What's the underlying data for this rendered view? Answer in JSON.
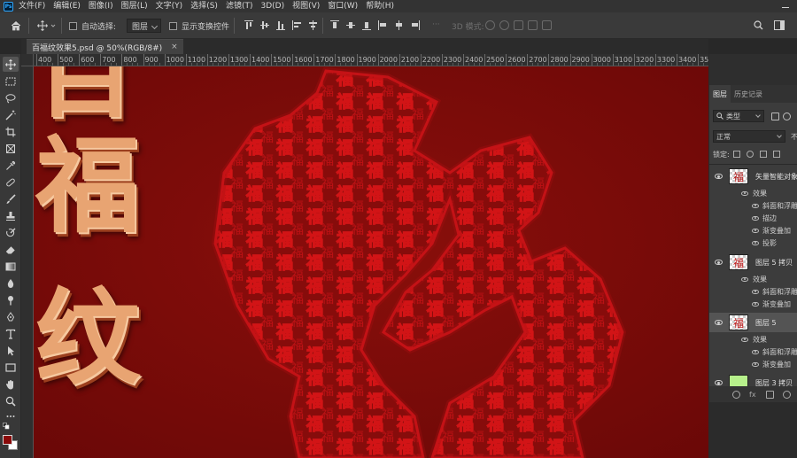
{
  "menu": {
    "items": [
      "文件(F)",
      "编辑(E)",
      "图像(I)",
      "图层(L)",
      "文字(Y)",
      "选择(S)",
      "滤镜(T)",
      "3D(D)",
      "视图(V)",
      "窗口(W)",
      "帮助(H)"
    ]
  },
  "options_bar": {
    "auto_select_label": "自动选择:",
    "auto_select_value": "图层",
    "show_transform_label": "显示变换控件",
    "mode_3d_label": "3D 模式:"
  },
  "document_tab": {
    "title": "百福纹效果5.psd @ 50%(RGB/8#)",
    "close": "×"
  },
  "ruler": {
    "labels": [
      "400",
      "500",
      "600",
      "700",
      "800",
      "900",
      "1000",
      "1100",
      "1200",
      "1300",
      "1400",
      "1500",
      "1600",
      "1700",
      "1800",
      "1900",
      "2000",
      "2100",
      "2200",
      "2300",
      "2400",
      "2500",
      "2600",
      "2700",
      "2800",
      "2900",
      "3000",
      "3100",
      "3200",
      "3300",
      "3400",
      "3500",
      "3600",
      "3700",
      "3800"
    ]
  },
  "canvas": {
    "chars": [
      "百",
      "福",
      "纹"
    ],
    "main_char": "福",
    "pattern_char": "福",
    "bg_color": "#7a0a09",
    "accent_color": "#d8161a"
  },
  "panel": {
    "tabs": [
      "图层",
      "历史记录"
    ],
    "filter_type": "类型",
    "blend_mode": "正常",
    "opacity_label": "不",
    "lock_label": "锁定:",
    "layers": [
      {
        "name": "矢量智能对象",
        "effects_label": "效果",
        "effects": [
          "斜面和浮雕",
          "描边",
          "渐变叠加",
          "投影"
        ]
      },
      {
        "name": "图层 5 拷贝",
        "effects_label": "效果",
        "effects": [
          "斜面和浮雕",
          "渐变叠加"
        ]
      },
      {
        "name": "图层 5",
        "effects_label": "效果",
        "effects": [
          "斜面和浮雕",
          "渐变叠加"
        ]
      },
      {
        "name": "图层 3 拷贝",
        "thumb_color": "#b7f08b"
      }
    ],
    "footer_fx": "fx"
  },
  "icons": [
    "home-icon",
    "move-icon",
    "marquee-icon",
    "lasso-icon",
    "magic-wand-icon",
    "crop-icon",
    "frame-icon",
    "eyedropper-icon",
    "healing-brush-icon",
    "brush-icon",
    "stamp-icon",
    "history-brush-icon",
    "eraser-icon",
    "gradient-icon",
    "blur-icon",
    "dodge-icon",
    "pen-icon",
    "type-icon",
    "path-select-icon",
    "rectangle-icon",
    "hand-icon",
    "zoom-icon",
    "more-icon",
    "search-icon",
    "workspace-icon"
  ]
}
